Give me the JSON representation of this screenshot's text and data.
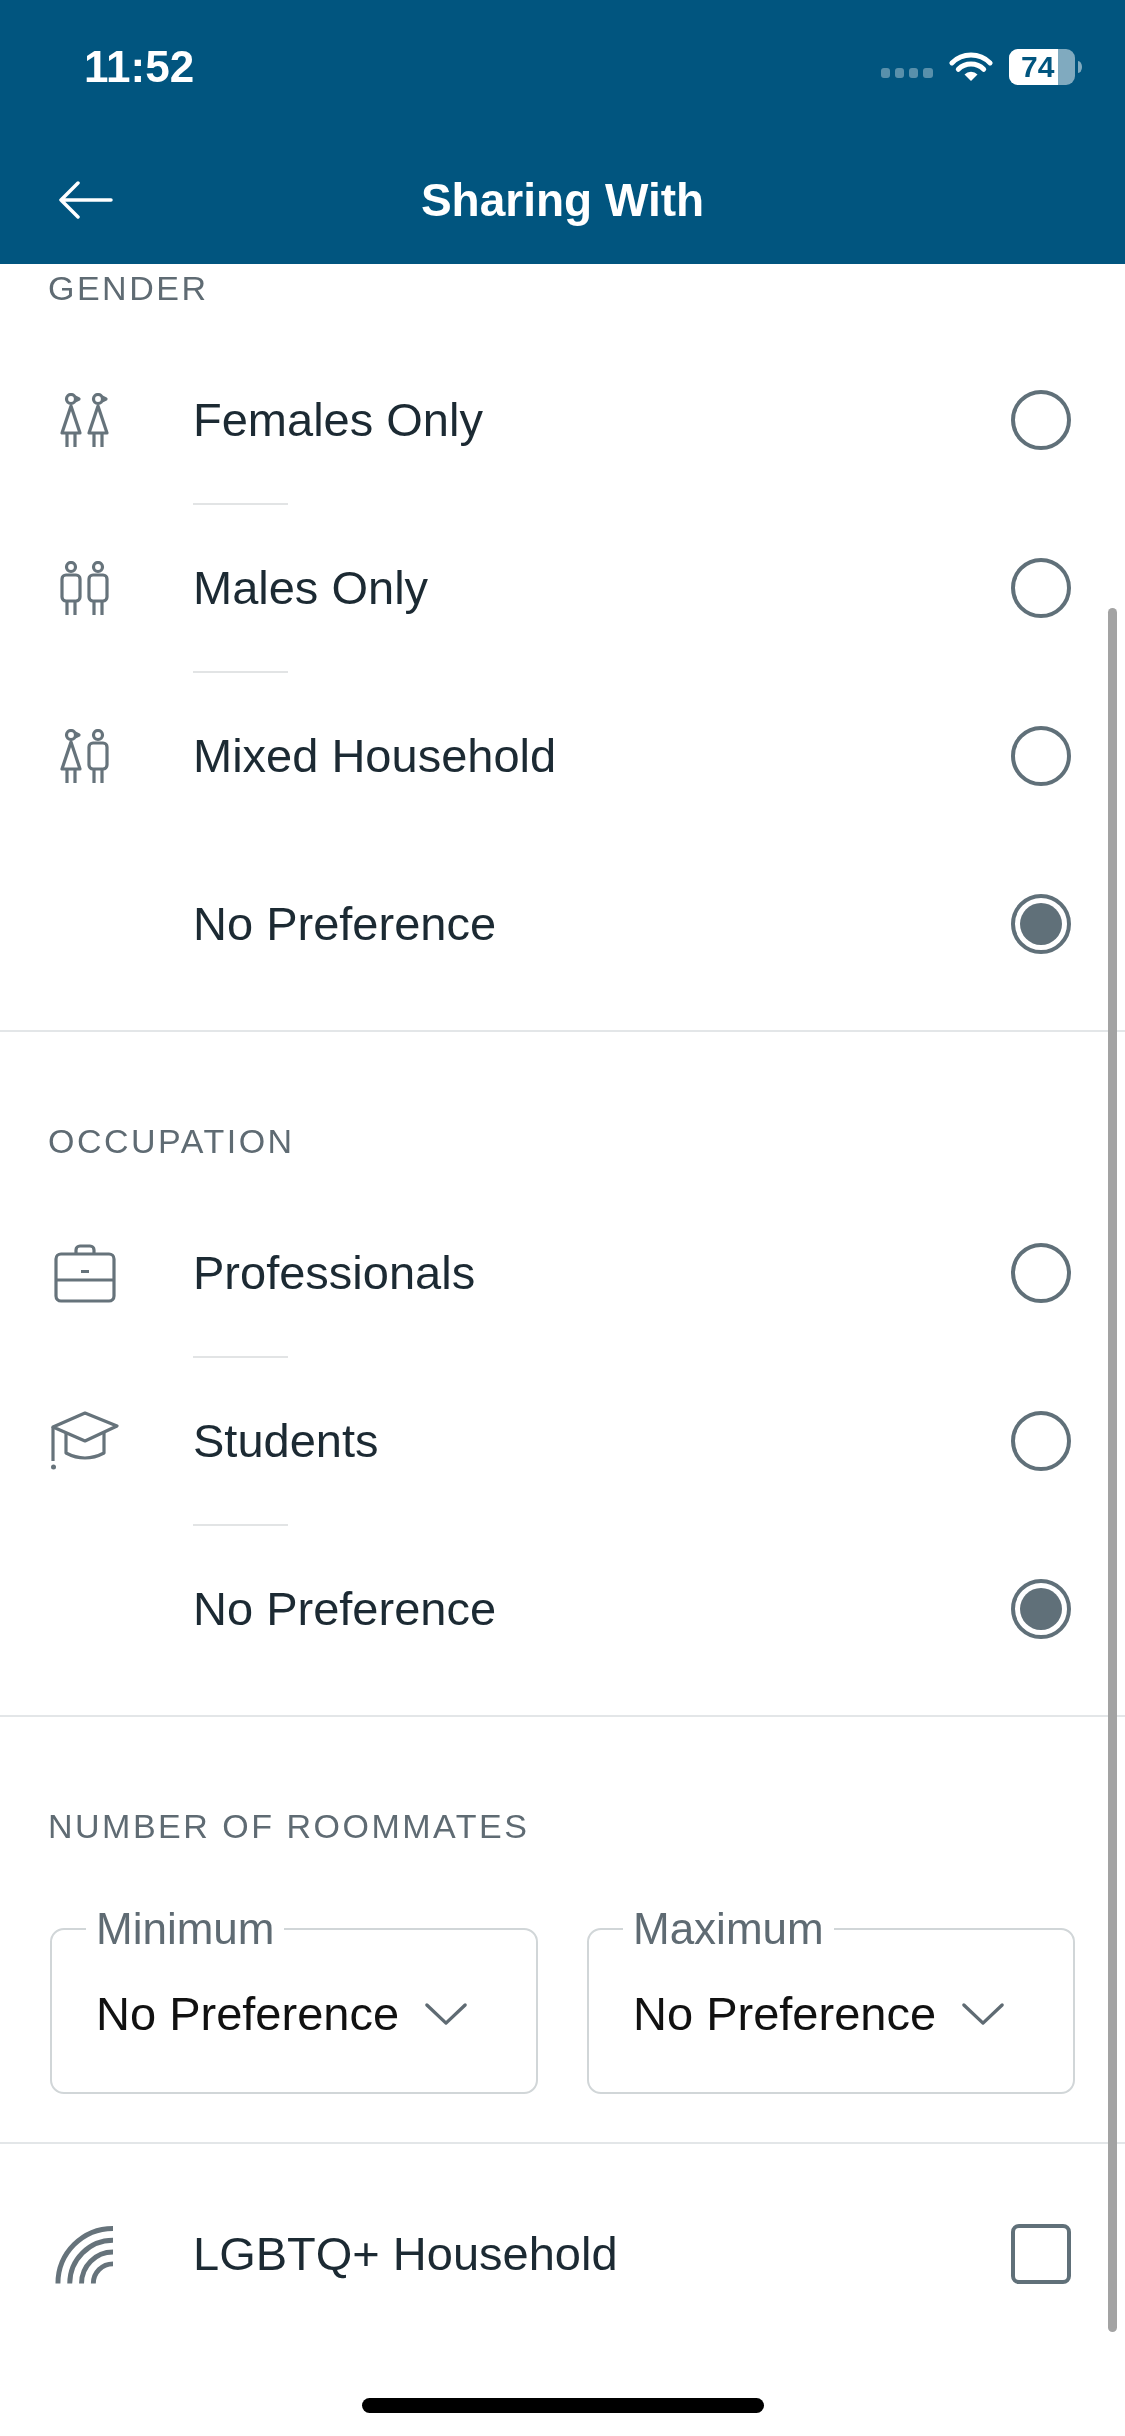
{
  "status_bar": {
    "time": "11:52",
    "battery": "74"
  },
  "header": {
    "title": "Sharing With"
  },
  "sections": [
    {
      "kind": "radio-list",
      "title": "GENDER",
      "options": [
        {
          "label": "Females Only",
          "kind": "female",
          "selected": false,
          "separator": true
        },
        {
          "label": "Males Only",
          "kind": "male",
          "selected": false,
          "separator": true
        },
        {
          "label": "Mixed Household",
          "kind": "mixed",
          "selected": false,
          "separator": false
        },
        {
          "label": "No Preference",
          "kind": "any",
          "selected": true,
          "separator": false
        }
      ]
    },
    {
      "kind": "radio-list",
      "title": "OCCUPATION",
      "options": [
        {
          "label": "Professionals",
          "kind": "professional",
          "selected": false,
          "separator": true
        },
        {
          "label": "Students",
          "kind": "student",
          "selected": false,
          "separator": true
        },
        {
          "label": "No Preference",
          "kind": "any",
          "selected": true,
          "separator": false
        }
      ]
    },
    {
      "kind": "range",
      "title": "NUMBER OF ROOMMATES",
      "dropdowns": [
        {
          "label": "Minimum",
          "value": "No Preference"
        },
        {
          "label": "Maximum",
          "value": "No Preference"
        }
      ]
    },
    {
      "kind": "checkbox",
      "label": "LGBTQ+ Household",
      "checked": false
    }
  ]
}
